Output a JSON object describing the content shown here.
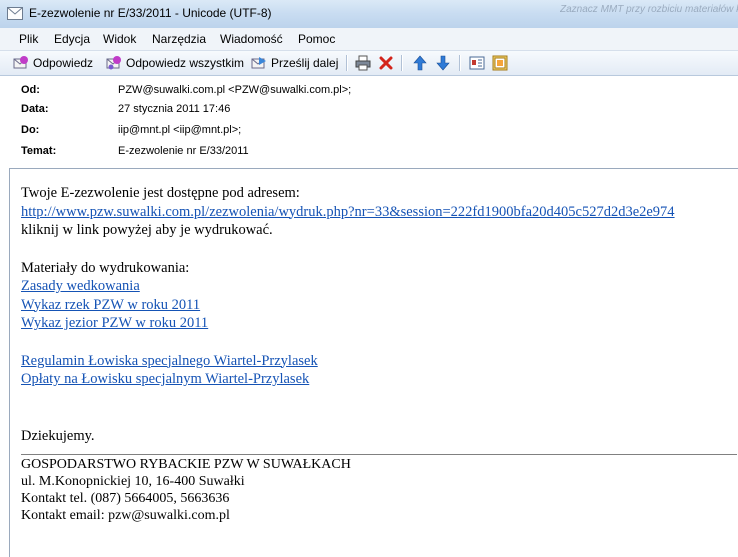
{
  "window": {
    "title": "E-zezwolenie nr E/33/2011 - Unicode (UTF-8)",
    "background_window_text": "Zaznacz MMT przy rozbiciu materiałów kontroln"
  },
  "menu": [
    "Plik",
    "Edycja",
    "Widok",
    "Narzędzia",
    "Wiadomość",
    "Pomoc"
  ],
  "toolbar": {
    "reply": "Odpowiedz",
    "reply_all": "Odpowiedz wszystkim",
    "forward": "Prześlij dalej"
  },
  "headers": {
    "from_label": "Od:",
    "from_value": "PZW@suwalki.com.pl <PZW@suwalki.com.pl>;",
    "date_label": "Data:",
    "date_value": "27 stycznia 2011 17:46",
    "to_label": "Do:",
    "to_value": "iip@mnt.pl <iip@mnt.pl>;",
    "subject_label": "Temat:",
    "subject_value": "E-zezwolenie nr E/33/2011"
  },
  "body": {
    "intro": "Twoje E-zezwolenie jest dostępne pod adresem:",
    "link": "http://www.pzw.suwalki.com.pl/zezwolenia/wydruk.php?nr=33&session=222fd1900bfa20d405c527d2d3e2e974",
    "instruction": "kliknij w link powyżej aby je wydrukować.",
    "materials_heading": "Materiały do wydrukowania:",
    "materials": [
      "Zasady wedkowania",
      "Wykaz rzek PZW w roku 2011",
      "Wykaz jezior PZW w roku 2011"
    ],
    "special_links": [
      "Regulamin Łowiska specjalnego Wiartel-Przylasek",
      "Opłaty na Łowisku specjalnym Wiartel-Przylasek"
    ],
    "thanks": "Dziekujemy.",
    "signature": [
      "GOSPODARSTWO RYBACKIE PZW W SUWAŁKACH",
      "ul. M.Konopnickiej 10, 16-400 Suwałki",
      "Kontakt tel. (087) 5664005, 5663636",
      "Kontakt email: pzw@suwalki.com.pl"
    ]
  }
}
